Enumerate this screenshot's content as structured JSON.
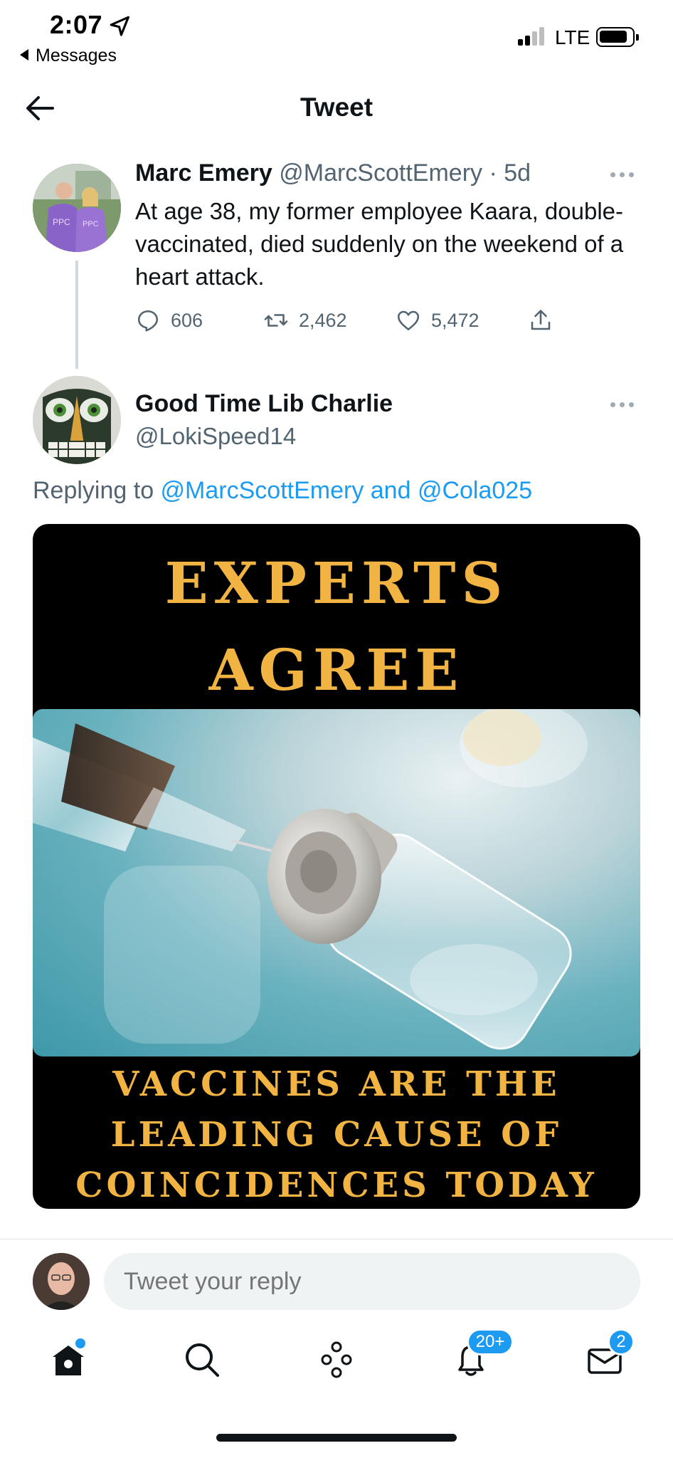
{
  "status_bar": {
    "time": "2:07",
    "back_app": "Messages",
    "network": "LTE"
  },
  "header": {
    "title": "Tweet"
  },
  "tweet1": {
    "name": "Marc Emery",
    "handle": "@MarcScottEmery",
    "separator": " · ",
    "age": "5d",
    "text": "At age 38, my former employee Kaara, double-vaccinated, died suddenly on the weekend of a heart attack.",
    "replies": "606",
    "retweets": "2,462",
    "likes": "5,472",
    "avatar_text": "PPC"
  },
  "tweet2": {
    "name": "Good Time Lib Charlie",
    "handle": "@LokiSpeed14",
    "replying_prefix": "Replying to ",
    "replying_targets": "@MarcScottEmery and @Cola025",
    "image": {
      "top_line1": "EXPERTS",
      "top_line2": "AGREE",
      "bottom_line1": "VACCINES ARE THE",
      "bottom_line2": "LEADING CAUSE OF",
      "bottom_line3": "COINCIDENCES TODAY"
    }
  },
  "composer": {
    "placeholder": "Tweet your reply"
  },
  "tabbar": {
    "notifications_badge": "20+",
    "messages_badge": "2"
  },
  "colors": {
    "accent": "#1d9bf0",
    "meme_text": "#f1b443",
    "muted": "#536471"
  },
  "icons": [
    "location-arrow-icon",
    "signal-icon",
    "battery-icon",
    "back-arrow-icon",
    "more-icon",
    "reply-icon",
    "retweet-icon",
    "like-icon",
    "share-icon",
    "home-icon",
    "search-icon",
    "spaces-icon",
    "notifications-icon",
    "messages-icon"
  ]
}
